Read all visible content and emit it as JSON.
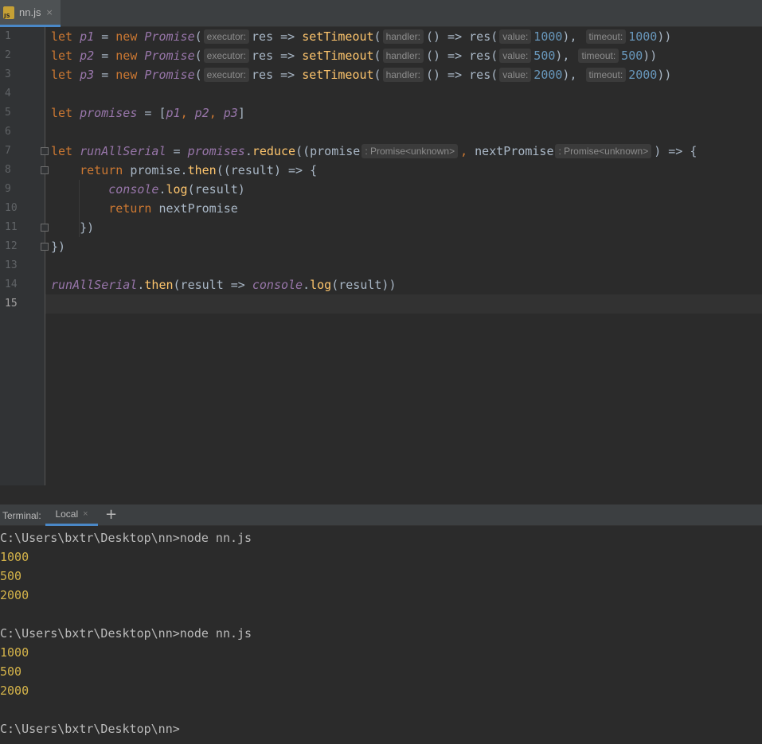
{
  "tabs": [
    {
      "label": "nn.js",
      "icon": "js-file-icon",
      "close": "×"
    }
  ],
  "editor": {
    "line_numbers": [
      "1",
      "2",
      "3",
      "4",
      "5",
      "6",
      "7",
      "8",
      "9",
      "10",
      "11",
      "12",
      "13",
      "14",
      "15"
    ],
    "current_line": 15,
    "lines": [
      [
        [
          "kw",
          "let "
        ],
        [
          "v",
          "p1"
        ],
        [
          "pl",
          " = "
        ],
        [
          "kw",
          "new "
        ],
        [
          "cls",
          "Promise"
        ],
        [
          "pl",
          "("
        ],
        [
          "hint",
          "executor:"
        ],
        [
          "pl",
          "res => "
        ],
        [
          "fn",
          "setTimeout"
        ],
        [
          "pl",
          "("
        ],
        [
          "hint",
          "handler:"
        ],
        [
          "pl",
          "() => res("
        ],
        [
          "hint",
          "value:"
        ],
        [
          "num",
          "1000"
        ],
        [
          "pl",
          "),"
        ],
        [
          "pl",
          " "
        ],
        [
          "hint",
          "timeout:"
        ],
        [
          "num",
          "1000"
        ],
        [
          "pl",
          "))"
        ]
      ],
      [
        [
          "kw",
          "let "
        ],
        [
          "v",
          "p2"
        ],
        [
          "pl",
          " = "
        ],
        [
          "kw",
          "new "
        ],
        [
          "cls",
          "Promise"
        ],
        [
          "pl",
          "("
        ],
        [
          "hint",
          "executor:"
        ],
        [
          "pl",
          "res => "
        ],
        [
          "fn",
          "setTimeout"
        ],
        [
          "pl",
          "("
        ],
        [
          "hint",
          "handler:"
        ],
        [
          "pl",
          "() => res("
        ],
        [
          "hint",
          "value:"
        ],
        [
          "num",
          "500"
        ],
        [
          "pl",
          "),"
        ],
        [
          "pl",
          " "
        ],
        [
          "hint",
          "timeout:"
        ],
        [
          "num",
          "500"
        ],
        [
          "pl",
          "))"
        ]
      ],
      [
        [
          "kw",
          "let "
        ],
        [
          "v",
          "p3"
        ],
        [
          "pl",
          " = "
        ],
        [
          "kw",
          "new "
        ],
        [
          "cls",
          "Promise"
        ],
        [
          "pl",
          "("
        ],
        [
          "hint",
          "executor:"
        ],
        [
          "pl",
          "res => "
        ],
        [
          "fn",
          "setTimeout"
        ],
        [
          "pl",
          "("
        ],
        [
          "hint",
          "handler:"
        ],
        [
          "pl",
          "() => res("
        ],
        [
          "hint",
          "value:"
        ],
        [
          "num",
          "2000"
        ],
        [
          "pl",
          "),"
        ],
        [
          "pl",
          " "
        ],
        [
          "hint",
          "timeout:"
        ],
        [
          "num",
          "2000"
        ],
        [
          "pl",
          "))"
        ]
      ],
      [],
      [
        [
          "kw",
          "let "
        ],
        [
          "v",
          "promises"
        ],
        [
          "pl",
          " = ["
        ],
        [
          "v",
          "p1"
        ],
        [
          "kw",
          ", "
        ],
        [
          "v",
          "p2"
        ],
        [
          "kw",
          ", "
        ],
        [
          "v",
          "p3"
        ],
        [
          "pl",
          "]"
        ]
      ],
      [],
      [
        [
          "kw",
          "let "
        ],
        [
          "v",
          "runAllSerial"
        ],
        [
          "pl",
          " = "
        ],
        [
          "v",
          "promises"
        ],
        [
          "pl",
          "."
        ],
        [
          "fn",
          "reduce"
        ],
        [
          "pl",
          "((promise"
        ],
        [
          "hint",
          ": Promise<unknown>"
        ],
        [
          "kw",
          ", "
        ],
        [
          "pl",
          "nextPromise"
        ],
        [
          "hint",
          ": Promise<unknown>"
        ],
        [
          "pl",
          ") => {"
        ]
      ],
      [
        [
          "pl",
          "    "
        ],
        [
          "kw",
          "return "
        ],
        [
          "pl",
          "promise."
        ],
        [
          "fn",
          "then"
        ],
        [
          "pl",
          "((result) => {"
        ]
      ],
      [
        [
          "pl",
          "        "
        ],
        [
          "v",
          "console"
        ],
        [
          "pl",
          "."
        ],
        [
          "fn",
          "log"
        ],
        [
          "pl",
          "(result)"
        ]
      ],
      [
        [
          "pl",
          "        "
        ],
        [
          "kw",
          "return "
        ],
        [
          "pl",
          "nextPromise"
        ]
      ],
      [
        [
          "pl",
          "    })"
        ]
      ],
      [
        [
          "pl",
          "})"
        ]
      ],
      [],
      [
        [
          "v",
          "runAllSerial"
        ],
        [
          "pl",
          "."
        ],
        [
          "fn",
          "then"
        ],
        [
          "pl",
          "(result => "
        ],
        [
          "v",
          "console"
        ],
        [
          "pl",
          "."
        ],
        [
          "fn",
          "log"
        ],
        [
          "pl",
          "(result))"
        ]
      ],
      []
    ]
  },
  "terminal": {
    "label": "Terminal:",
    "tab_label": "Local",
    "tab_close": "×",
    "add_label": "+",
    "lines": [
      {
        "kind": "cmd",
        "text": "C:\\Users\\bxtr\\Desktop\\nn>node nn.js"
      },
      {
        "kind": "out",
        "text": "1000"
      },
      {
        "kind": "out",
        "text": "500"
      },
      {
        "kind": "out",
        "text": "2000"
      },
      {
        "kind": "cmd",
        "text": ""
      },
      {
        "kind": "cmd",
        "text": "C:\\Users\\bxtr\\Desktop\\nn>node nn.js"
      },
      {
        "kind": "out",
        "text": "1000"
      },
      {
        "kind": "out",
        "text": "500"
      },
      {
        "kind": "out",
        "text": "2000"
      },
      {
        "kind": "cmd",
        "text": ""
      },
      {
        "kind": "cmd",
        "text": "C:\\Users\\bxtr\\Desktop\\nn>"
      }
    ]
  }
}
